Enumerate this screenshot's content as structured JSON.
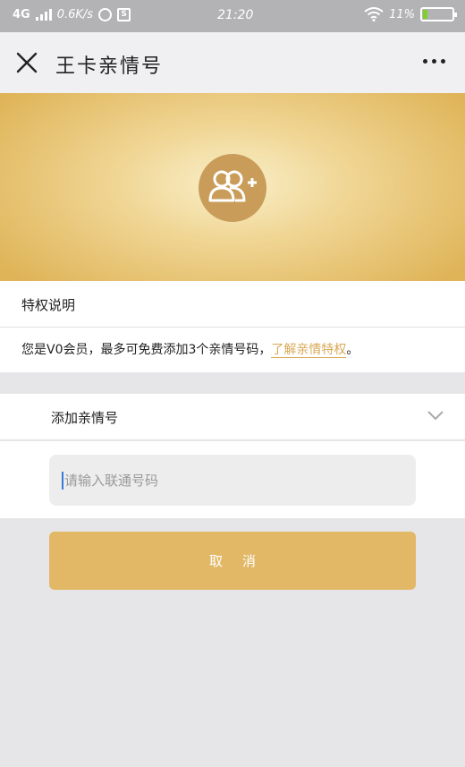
{
  "status_bar": {
    "network": "4G",
    "speed": "0.6K/s",
    "time": "21:20",
    "battery": "11%"
  },
  "navbar": {
    "title": "王卡亲情号"
  },
  "banner": {
    "icon": "add-user-icon",
    "gradient_colors": [
      "#f9efc9",
      "#dfb458"
    ]
  },
  "privilege": {
    "heading": "特权说明",
    "description": "您是V0会员，最多可免费添加3个亲情号码，",
    "link": "了解亲情特权",
    "end": "。"
  },
  "add_section": {
    "label": "添加亲情号",
    "input_placeholder": "请输入联通号码",
    "cancel_label": "取消"
  },
  "colors": {
    "accent": "#e2b867",
    "link": "#d8a956"
  }
}
